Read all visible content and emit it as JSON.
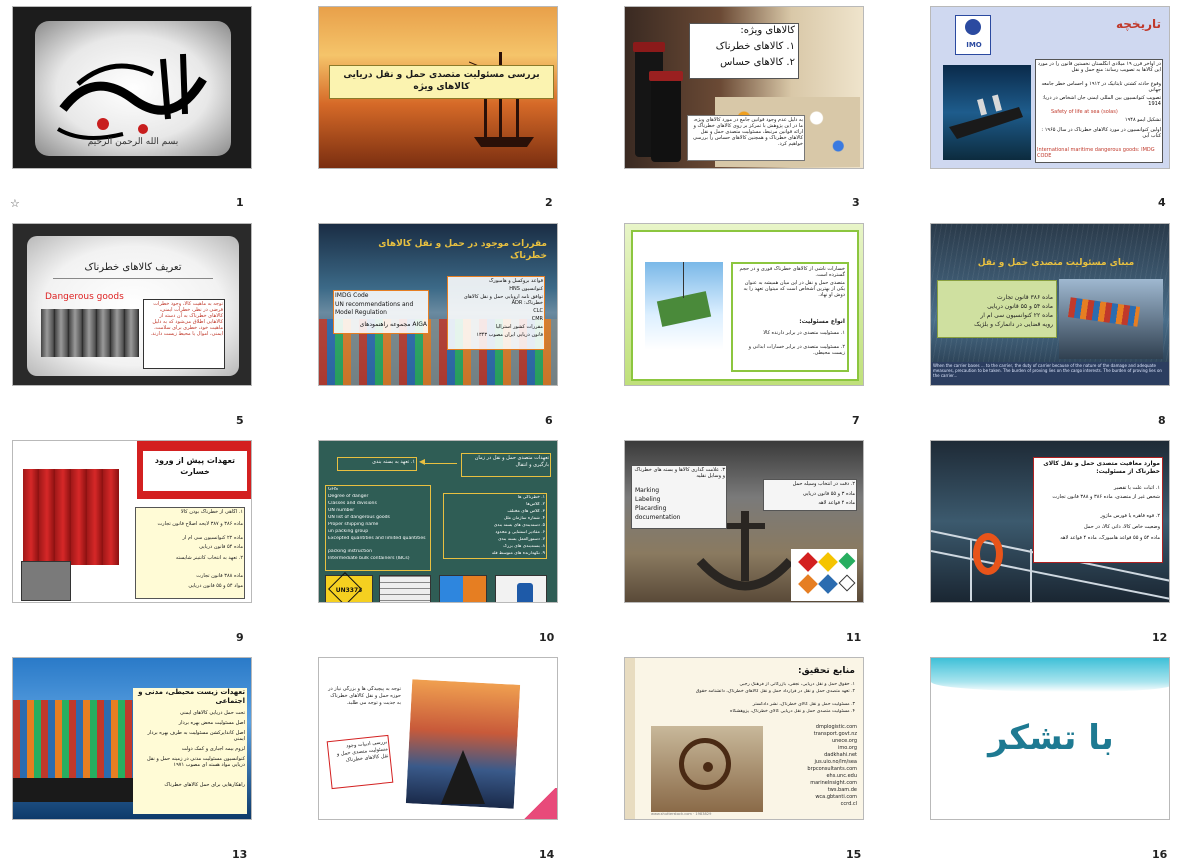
{
  "slides": [
    {
      "num": "1",
      "calligraphy": "بسم الله الرحمن الرحیم"
    },
    {
      "num": "2",
      "title": "بررسی مسئولیت متصدی حمل و نقل دریایی کالاهای ویژه"
    },
    {
      "num": "3",
      "heading": "کالاهای ویژه:",
      "items": [
        "۱. کالاهای خطرناک",
        "۲. کالاهای حساس"
      ],
      "body": "به دلیل عدم وجود قوانین جامع در مورد کالاهای ویژه، ما در این پژوهش با تمرکز بر روی کالاهای خطرناک و ارائه قوانین مرتبط، مسئولیت متصدی حمل و نقل کالاهای خطرناک و همچنین کالاهای حساس را بررسی خواهیم کرد."
    },
    {
      "num": "4",
      "title": "تاریخچه",
      "logo": "IMO",
      "bullets": [
        "در اواخر قرن ۱۹ میلادی انگلستان نخستین قانون را در مورد این کالاها به تصویب رساند: منع حمل و نقل",
        "وقوع حادثه کشتی تایتانیک در ۱۹۱۲ و احساس خطر جامعه جهانی",
        "تصویب کنوانسیون بین المللی ایمنی جان اشخاص در دریا: 1914",
        "تشکیل ایمو ۱۹۴۸",
        "اولین کنوانسیون در مورد کالاهای خطرناک در سال ۱۹۶۵ : کتاب آبی"
      ],
      "english1": "Safety of life at sea (solas)",
      "english2": "International maritime dangerous goods: IMDG CODE"
    },
    {
      "num": "5",
      "title": "تعریف کالاهای خطرناک",
      "subtitle": "Dangerous goods",
      "definition": "توجه به ماهیت کالا، وجود خطرات فرضی در نظر، خطرات ایمنی، کالاهای خطرناک به آن دسته از کالاهایی اطلاق می‌شود که به دلیل ماهیت خود، خطری برای سلامت، ایمنی، اموال یا محیط زیست دارند."
    },
    {
      "num": "6",
      "title": "مقررات موجود در حمل و نقل کالاهای خطرناک",
      "left": [
        "IMDG Code",
        "UN recommendations and Model Regulation",
        "AIGA مجموعه راهنمودهای"
      ],
      "right": [
        "قواعد بروکسل و هامبورگ",
        "کنوانسیون HNS",
        "توافق نامه اروپایی حمل و نقل کالاهای خطرناک: ADR",
        "CLC",
        "CMR",
        "مقررات کشور استرالیا",
        "قانون دریایی ایران مصوب ۱۳۴۳"
      ]
    },
    {
      "num": "7",
      "points": [
        "خسارات ناشی از کالاهای خطرناک فوری و در حجم گسترده است.",
        "متصدی حمل و نقل در این میان همیشه به عنوان یکی از بهترین اشخاص است که میتوان تعهد را به دوش او نهاد."
      ],
      "heading": "انواع مسئولیت:",
      "types": [
        "۱. مسئولیت متصدی در برابر دارنده کالا",
        "۲. مسئولیت متصدی در برابر خسارات ابدانی و زیست محیطی."
      ]
    },
    {
      "num": "8",
      "title": "مبنای مسئولیت متصدی حمل و نقل",
      "laws": [
        "ماده ۳۸۶ قانون تجارت",
        "ماده ۵۴ و ۵۵ قانون دریایی",
        "ماده ۲۲ کنوانسیون سی ام آر",
        "رویه قضایی در دانمارک و بلژیک"
      ],
      "english": "When the carrier bases ... to the carrier, the duty of carrier because of the nature of the damage and adequate measures, precaution to be taken. The burden of proving lies on the cargo interests. The burden of proving lies on the carrier..."
    },
    {
      "num": "9",
      "title": "تعهدات پیش از ورود خسارت",
      "items": [
        "۱. آگاهی از خطرناک بودن کالا",
        "ماده ۳۸۶ و ۳۸۷ لایحه اصلاح قانون تجارت",
        "ماده ۲۲ کنوانسیون سی ام آر",
        "ماده ۵۴ قانون دریایی",
        "۲. تعهد به انتخاب کانتینر شایسته",
        "ماده ۳۸۸ قانون تجارت",
        "مواد ۵۴ و ۵۵ قانون دریایی"
      ]
    },
    {
      "num": "10",
      "title": "تعهدات متصدی حمل و نقل در زمان بارگیری و انتقال",
      "arrowLabel": "۱. تعهد به بسته بندی",
      "leftList": [
        "GHS",
        "Degree of danger",
        "Classes and divisions",
        "UN number",
        "UN list of dangerous goods",
        "Proper shipping name",
        "un packing group",
        "Excepted quantities and limited quantities",
        "packing instruction",
        "Intermediate bulk containers (IBCs)"
      ],
      "rightList": [
        "۱. خطرناکی ها",
        "۲. کلاس‌ها",
        "۳. کلاس های مختلف",
        "۴. شماره سازمان ملل",
        "۵. دسته‌بندی های بسته بندی",
        "۶. مقادیر استثنایی و محدود",
        "۷. دستورالعمل بسته بندی",
        "۸. بسته‌بندی های بزرگ",
        "۹. نگهدارنده های متوسط فله"
      ],
      "badge": "UN3373"
    },
    {
      "num": "11",
      "left": "۳. علامت گذاری کالاها و بسته های خطرناک و وسایل نقلیه",
      "leftEn": [
        "Marking",
        "Labeling",
        "Placarding",
        "documentation"
      ],
      "right": "۲. دقت در انتخاب وسیله حمل",
      "laws": [
        "ماده ۳ و ۵۵ قانون دریایی",
        "ماده ۴ قواعد لاهه"
      ]
    },
    {
      "num": "12",
      "title": "موارد معافیت متصدی حمل و نقل کالای خطرناک از مسئولیت:",
      "items": [
        "۱. اثبات علت یا تقصیر",
        "شخص غیر از متصدی، ماده ۳۸۶ و ۳۸۸ قانون تجارت",
        "۲. قوه قاهره یا فورس ماژور",
        "وضعیت خاص کالا، ذاتی کالا، در حمل",
        "ماده ۵۴ و ۵۵ قواعد هامبورگ، ماده ۴ قواعد لاهه"
      ]
    },
    {
      "num": "13",
      "title": "تعهدات زیست محیطی، مدنی و اجتماعی",
      "bullets": [
        "تحت حمل دریایی کالاهای ایمنی",
        "اصل مسئولیت محض بهره بردار",
        "اصل کاندایرکشن مسئولیت به طرف بهره بردار ایمنی",
        "لزوم بیمه اجباری و کمک دولت",
        "کنوانسیون مسئولیت مدنی در زمینه حمل و نقل دریایی مواد هسته ای مصوب ۱۹۷۱",
        "راهکارهایی برای حمل کالاهای خطرناک"
      ]
    },
    {
      "num": "14",
      "topText": "توجه به پیچیدگی ها و بزرگی نیاز در حوزه حمل و نقل کالاهای خطرناک به جدیت و توجه می طلبد.",
      "boxText": "بررسی ادبیات وجود مسئولیت متصدی حمل و نقل کالاهای خطرناک"
    },
    {
      "num": "15",
      "title": "منابع تحقیق:",
      "refs": [
        "۱. حقوق حمل و نقل دریایی، نجفی، بازرگانی از فرهنگ رجبی",
        "۲. تعهد متصدی حمل و نقل در قرارداد حمل و نقل کالاهای خطرناک، دانشنامه حقوق",
        "۳. مسئولیت حمل و نقل کالای خطرناک، نشر دادگستر",
        "۴. مسئولیت متصدی حمل و نقل دریایی کالای خطرناک، پژوهشگاه"
      ],
      "links": [
        "dmplogistic.com",
        "transport.govt.nz",
        "unece.org",
        "imo.org",
        "dadkhahi.net",
        "jus.uio.no/lm/sea",
        "brpconsultants.com",
        "ehs.unc.edu",
        "marinelnsight.com",
        "tws.bam.de",
        "wca.gbtanti.com",
        "ccrd.cl"
      ],
      "watermark": "www.shutterstock.com · 1983829"
    },
    {
      "num": "16",
      "title": "با تشکر"
    }
  ]
}
